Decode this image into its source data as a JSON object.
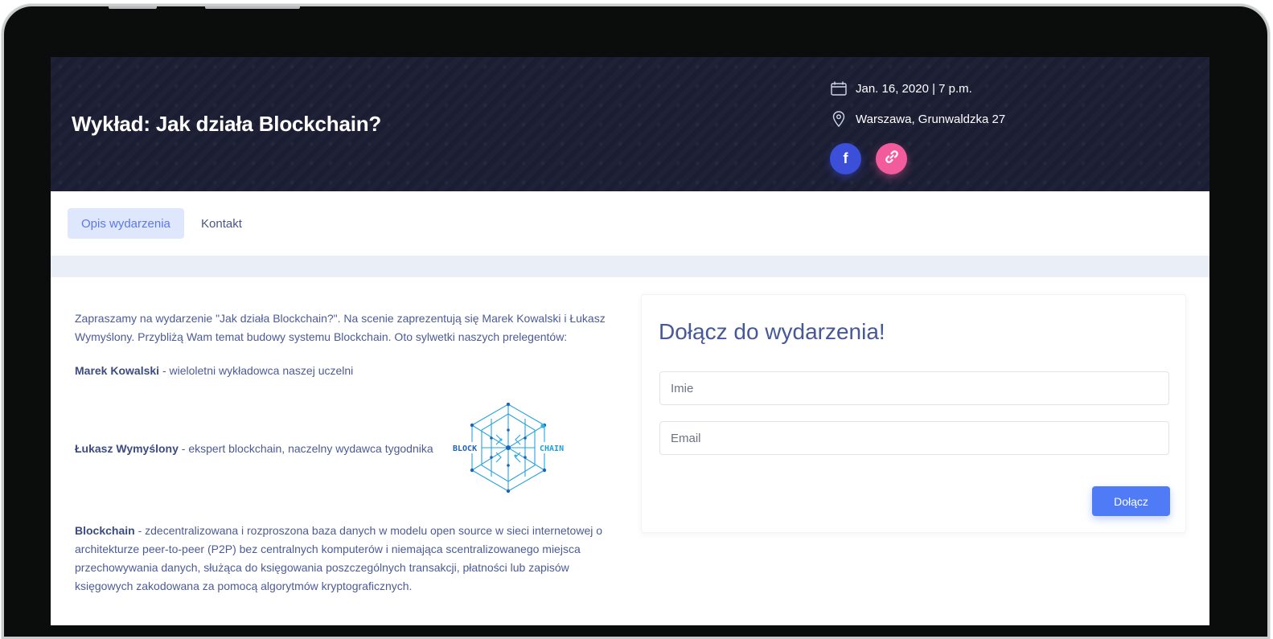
{
  "hero": {
    "title": "Wykład: Jak działa Blockchain?",
    "date": "Jan. 16, 2020 | 7 p.m.",
    "location": "Warszawa, Grunwaldzka 27",
    "social": [
      {
        "icon": "facebook-icon",
        "glyph": "f",
        "color": "#3b4fd8"
      },
      {
        "icon": "link-icon",
        "color": "#f25c9c"
      }
    ]
  },
  "tabs": [
    {
      "label": "Opis wydarzenia",
      "active": true
    },
    {
      "label": "Kontakt",
      "active": false
    }
  ],
  "description": {
    "intro": "Zapraszamy na wydarzenie \"Jak działa Blockchain?\". Na scenie zaprezentują się Marek Kowalski i Łukasz Wymyślony. Przybliżą Wam temat budowy systemu Blockchain. Oto sylwetki naszych prelegentów:",
    "speaker1_name": "Marek Kowalski",
    "speaker1_desc": " - wieloletni wykładowca naszej uczelni",
    "speaker2_name": "Łukasz Wymyślony",
    "speaker2_desc": " - ekspert blockchain, naczelny wydawca tygodnika",
    "term": "Blockchain",
    "term_desc": " - zdecentralizowana i rozproszona baza danych w modelu open source w sieci internetowej o architekturze peer-to-peer (P2P) bez centralnych komputerów i niemająca scentralizowanego miejsca przechowywania danych, służąca do księgowania poszczególnych transakcji, płatności lub zapisów księgowych zakodowana za pomocą algorytmów kryptograficznych."
  },
  "logo": {
    "left_text": "BLOCK",
    "right_text": "CHAIN"
  },
  "form": {
    "title": "Dołącz do wydarzenia!",
    "name_placeholder": "Imie",
    "email_placeholder": "Email",
    "submit_label": "Dołącz"
  },
  "colors": {
    "hero_bg": "#1b1d33",
    "accent": "#4f7bf7",
    "text": "#4c5b97"
  }
}
